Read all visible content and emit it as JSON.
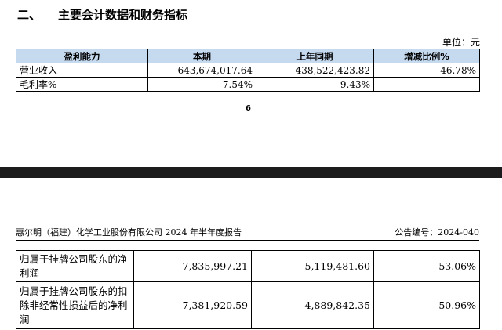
{
  "section": {
    "number": "二、",
    "title": "主要会计数据和财务指标"
  },
  "unit_label": "单位：元",
  "table1": {
    "headers": [
      "盈利能力",
      "本期",
      "上年同期",
      "增减比例%"
    ],
    "rows": [
      {
        "label": "营业收入",
        "current": "643,674,017.64",
        "prior": "438,522,423.82",
        "change": "46.78%"
      },
      {
        "label": "毛利率%",
        "current": "7.54%",
        "prior": "9.43%",
        "change": "-"
      }
    ]
  },
  "page_number": "6",
  "doc_header": {
    "company_report": "惠尔明（福建）化学工业股份有限公司 2024 年半年度报告",
    "announcement_no": "公告编号：2024-040"
  },
  "table2": {
    "rows": [
      {
        "label": "归属于挂牌公司股东的净利润",
        "current": "7,835,997.21",
        "prior": "5,119,481.60",
        "change": "53.06%"
      },
      {
        "label": "归属于挂牌公司股东的扣除非经常性损益后的净利润",
        "current": "7,381,920.59",
        "prior": "4,889,842.35",
        "change": "50.96%"
      }
    ]
  }
}
